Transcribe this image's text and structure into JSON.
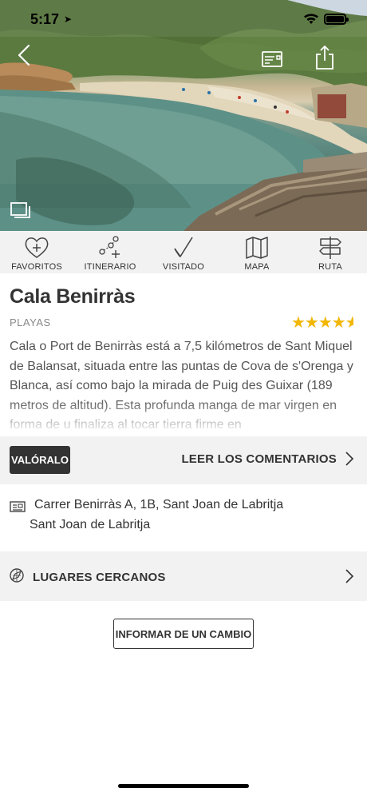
{
  "status_bar": {
    "time": "5:17",
    "location_glyph": "➤"
  },
  "hero": {
    "icons": [
      "back-arrow-icon",
      "ticket-icon",
      "share-icon",
      "gallery-icon"
    ]
  },
  "actions": [
    {
      "label": "FAVORITOS",
      "icon": "heart-plus-icon"
    },
    {
      "label": "ITINERARIO",
      "icon": "itinerary-icon"
    },
    {
      "label": "VISITADO",
      "icon": "checkmark-icon"
    },
    {
      "label": "MAPA",
      "icon": "map-icon"
    },
    {
      "label": "RUTA",
      "icon": "signpost-icon"
    }
  ],
  "place": {
    "title": "Cala Benirràs",
    "category": "PLAYAS",
    "rating": 4.5,
    "stars_full": "★★★★",
    "stars_half": "★",
    "description": "Cala o Port de Benirràs está a 7,5 kilómetros de Sant Miquel de Balansat, situada entre las puntas de Cova de s'Orenga y Blanca, así como bajo la mirada de Puig des Guixar (189 metros de altitud). Esta profunda manga de mar virgen en forma de u finaliza al tocar tierra firme en"
  },
  "rate_row": {
    "rate_label": "VALÓRALO",
    "comments_label": "LEER LOS COMENTARIOS"
  },
  "address": {
    "line1": "Carrer Benirràs A, 1B, Sant Joan de Labritja",
    "line2": "Sant Joan de Labritja"
  },
  "nearby": {
    "label": "LUGARES CERCANOS"
  },
  "report": {
    "label": "INFORMAR DE UN CAMBIO"
  },
  "colors": {
    "star": "#f2b705",
    "bar_bg": "#f2f2f2",
    "dark_button": "#333333"
  }
}
